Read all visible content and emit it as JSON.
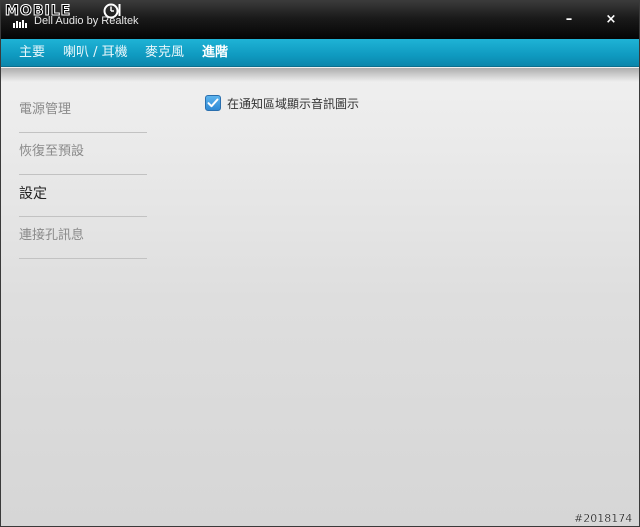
{
  "titlebar": {
    "logo_text": "MOBILE",
    "subtitle": "Dell Audio by Realtek",
    "minimize_glyph": "–",
    "close_glyph": "×"
  },
  "tabs": [
    {
      "label": "主要",
      "active": false
    },
    {
      "label": "喇叭 / 耳機",
      "active": false
    },
    {
      "label": "麥克風",
      "active": false
    },
    {
      "label": "進階",
      "active": true
    }
  ],
  "sidebar": {
    "items": [
      {
        "label": "電源管理",
        "active": false
      },
      {
        "label": "恢復至預設",
        "active": false
      },
      {
        "label": "設定",
        "active": true
      },
      {
        "label": "連接孔訊息",
        "active": false
      }
    ]
  },
  "settings": {
    "show_tray_icon": {
      "label": "在通知區域顯示音訊圖示",
      "checked": true
    }
  },
  "watermark": "#2018174",
  "colors": {
    "titlebar": "#0a0a0a",
    "tabbar": "#1aa7cc",
    "checkbox": "#3b95dd",
    "nav_inactive": "#8a8a8a",
    "nav_active": "#222222"
  }
}
